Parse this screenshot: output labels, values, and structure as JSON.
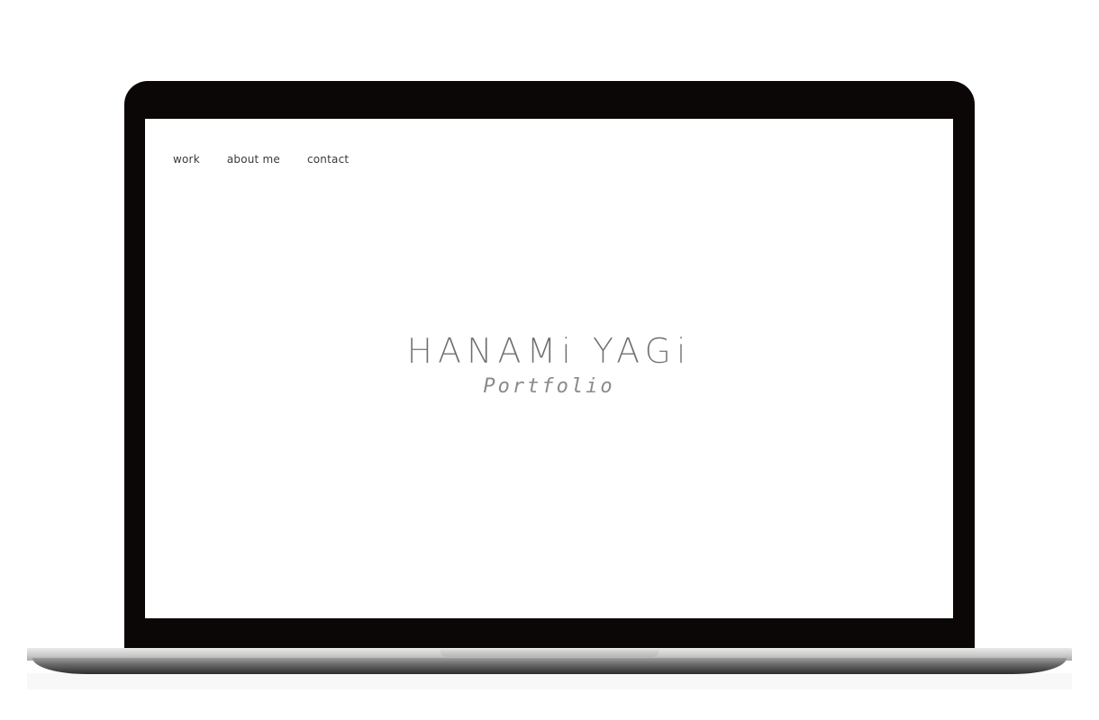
{
  "nav": {
    "items": [
      {
        "label": "work"
      },
      {
        "label": "about me"
      },
      {
        "label": "contact"
      }
    ]
  },
  "hero": {
    "title": "HANAMi YAGi",
    "subtitle": "Portfolio"
  },
  "colors": {
    "laptop_frame": "#0c0707",
    "screen_background": "#ffffff",
    "title_text": "#6e6e6e",
    "nav_text": "#3a3a3a"
  }
}
